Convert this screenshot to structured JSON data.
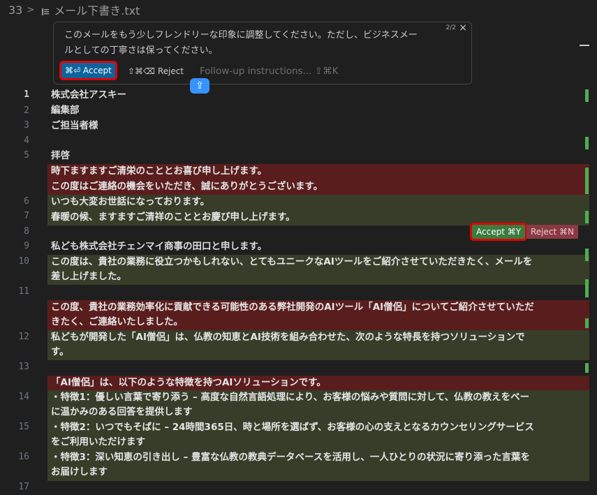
{
  "breadcrumb": {
    "line": "33",
    "chevron": ">",
    "filename": "メール下書き.txt"
  },
  "prompt": {
    "line1": "このメールをもう少しフレンドリーな印象に調整してください。ただし、ビジネスメー",
    "line2": "ルとしての丁寧さは保ってください。",
    "counter": "2/2",
    "close": "×",
    "accept_label": "⌘⏎ Accept",
    "reject_label": "⇧⌘⌫ Reject",
    "followup_placeholder": "Follow-up instructions... ⇧⌘K"
  },
  "upload_icon": "⇪",
  "inline_actions": {
    "accept_label": "Accept ⌘Y",
    "reject_label": "Reject ⌘N"
  },
  "gutter": [
    "1",
    "2",
    "3",
    "4",
    "5",
    "6",
    "7",
    "8",
    "9",
    "10",
    "11",
    "12",
    "13",
    "14",
    "15",
    "16",
    "17"
  ],
  "editor": {
    "l1": "株式会社アスキー",
    "l2": "編集部",
    "l3": "ご担当者様",
    "l5": "拝啓",
    "d1": "時下ますますご清栄のこととお喜び申し上げます。",
    "d2": "この度はご連絡の機会をいただき、誠にありがとうございます。",
    "l6": "いつも大変お世話になっております。",
    "l7": "春暖の候、ますますご清祥のこととお慶び申し上げます。",
    "l9": "私ども株式会社チェンマイ商事の田口と申します。",
    "l10a": "この度は、貴社の業務に役立つかもしれない、とてもユニークなAIツールをご紹介させていただきたく、メールを",
    "l10b": "差し上げました。",
    "d3a": "この度、貴社の業務効率化に貢献できる可能性のある弊社開発のAIツール「AI僧侶」についてご紹介させていただ",
    "d3b": "きたく、ご連絡いたしました。",
    "l12a": "私どもが開発した「AI僧侶」は、仏教の知恵とAI技術を組み合わせた、次のような特長を持つソリューションで",
    "l12b": "す。",
    "d4": "「AI僧侶」は、以下のような特徴を持つAIソリューションです。",
    "l14a": "・特徴1：優しい言葉で寄り添う – 高度な自然言語処理により、お客様の悩みや質問に対して、仏教の教えをベー",
    "l14b": "ス",
    "l14c": "に温かみのある回答を提供します",
    "l15a": "・特徴2：いつでもそばに – 24時間365日、時と場所を選ばず、お客様の心の支えとなるカウンセリングサービス",
    "l15b": "をご利用いただけます",
    "l16a": "・特徴3：深い知恵の引き出し – 豊富な仏教の教典データベースを活用し、一人ひとりの状況に寄り添った言葉を",
    "l16b": "お届けします"
  },
  "colors": {
    "deleted_bg": "#5a1d1d",
    "added_bg": "#373d29",
    "accept_blue": "#0e639c",
    "accept_green": "#3c7b3f",
    "reject_red": "#8a3a44",
    "highlight": "#e00000"
  }
}
